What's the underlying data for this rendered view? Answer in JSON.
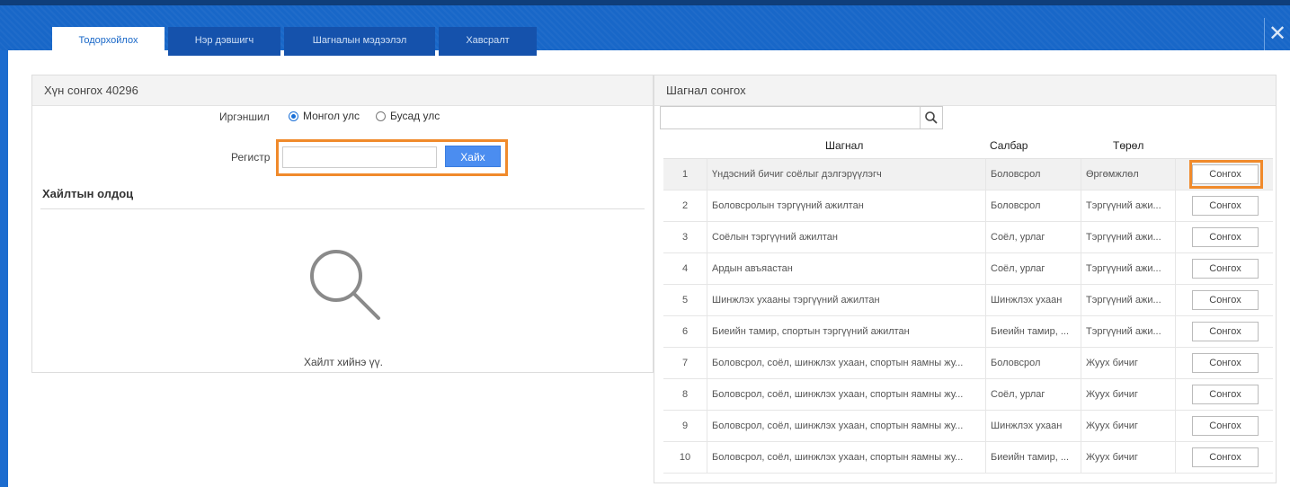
{
  "tabs": [
    {
      "label": "Тодорхойлох",
      "active": true
    },
    {
      "label": "Нэр дэвшигч",
      "active": false
    },
    {
      "label": "Шагналын мэдээлэл",
      "active": false
    },
    {
      "label": "Хавсралт",
      "active": false
    }
  ],
  "close_icon": "close-icon",
  "left_panel": {
    "title": "Хүн сонгох 40296",
    "citizenship_label": "Иргэншил",
    "radio_options": [
      {
        "label": "Монгол улс",
        "selected": true
      },
      {
        "label": "Бусад улс",
        "selected": false
      }
    ],
    "register_label": "Регистр",
    "register_value": "",
    "search_button": "Хайх",
    "results_title": "Хайлтын олдоц",
    "empty_icon": "search-icon",
    "empty_text": "Хайлт хийнэ үү."
  },
  "right_panel": {
    "title": "Шагнал сонгох",
    "filter_value": "",
    "filter_icon": "search-icon",
    "columns": [
      "Шагнал",
      "Салбар",
      "Төрөл"
    ],
    "select_label": "Сонгох",
    "rows": [
      {
        "num": "1",
        "award": "Үндэсний бичиг соёлыг дэлгэрүүлэгч",
        "branch": "Боловсрол",
        "type": "Өргөмжлөл",
        "highlighted": true
      },
      {
        "num": "2",
        "award": "Боловсролын тэргүүний ажилтан",
        "branch": "Боловсрол",
        "type": "Тэргүүний ажи...",
        "highlighted": false
      },
      {
        "num": "3",
        "award": "Соёлын тэргүүний ажилтан",
        "branch": "Соёл, урлаг",
        "type": "Тэргүүний ажи...",
        "highlighted": false
      },
      {
        "num": "4",
        "award": "Ардын авъяастан",
        "branch": "Соёл, урлаг",
        "type": "Тэргүүний ажи...",
        "highlighted": false
      },
      {
        "num": "5",
        "award": "Шинжлэх ухааны тэргүүний ажилтан",
        "branch": "Шинжлэх ухаан",
        "type": "Тэргүүний ажи...",
        "highlighted": false
      },
      {
        "num": "6",
        "award": "Биеийн тамир, спортын тэргүүний ажилтан",
        "branch": "Биеийн тамир, ...",
        "type": "Тэргүүний ажи...",
        "highlighted": false
      },
      {
        "num": "7",
        "award": "Боловсрол, соёл, шинжлэх ухаан, спортын яамны жу...",
        "branch": "Боловсрол",
        "type": "Жуух бичиг",
        "highlighted": false
      },
      {
        "num": "8",
        "award": "Боловсрол, соёл, шинжлэх ухаан, спортын яамны жу...",
        "branch": "Соёл, урлаг",
        "type": "Жуух бичиг",
        "highlighted": false
      },
      {
        "num": "9",
        "award": "Боловсрол, соёл, шинжлэх ухаан, спортын яамны жу...",
        "branch": "Шинжлэх ухаан",
        "type": "Жуух бичиг",
        "highlighted": false
      },
      {
        "num": "10",
        "award": "Боловсрол, соёл, шинжлэх ухаан, спортын яамны жу...",
        "branch": "Биеийн тамир, ...",
        "type": "Жуух бичиг",
        "highlighted": false
      }
    ]
  },
  "colors": {
    "header_blue": "#1867c8",
    "highlight_orange": "#f08a2b",
    "button_blue": "#4b8df0"
  }
}
